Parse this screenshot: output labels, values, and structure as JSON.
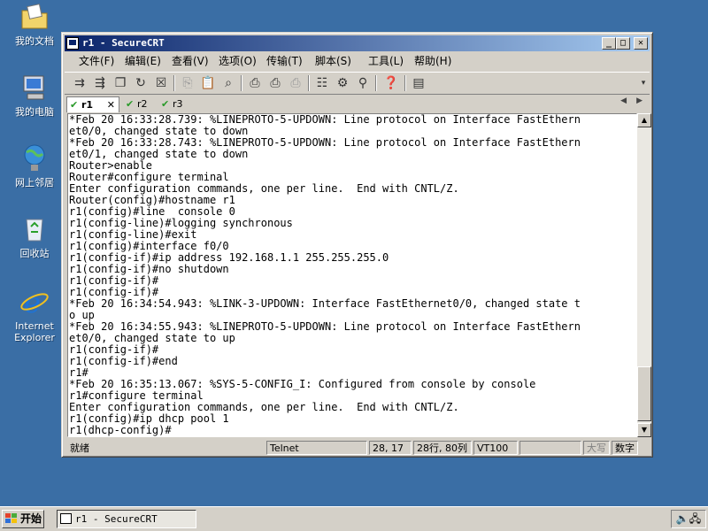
{
  "desktop": {
    "icons": [
      {
        "label": "我的文档",
        "icon": "folder-documents-icon"
      },
      {
        "label": "我的电脑",
        "icon": "computer-icon"
      },
      {
        "label": "网上邻居",
        "icon": "network-icon"
      },
      {
        "label": "回收站",
        "icon": "recycle-bin-icon"
      },
      {
        "label": "Internet Explorer",
        "icon": "ie-icon"
      }
    ]
  },
  "window": {
    "title": "r1 - SecureCRT",
    "controls": {
      "minimize": "_",
      "maximize": "□",
      "close": "✕"
    }
  },
  "menu": [
    "文件(F)",
    "编辑(E)",
    "查看(V)",
    "选项(O)",
    "传输(T)",
    "脚本(S)",
    "工具(L)",
    "帮助(H)"
  ],
  "tabs": [
    {
      "label": "r1",
      "active": true,
      "close": "✕"
    },
    {
      "label": "r2",
      "active": false
    },
    {
      "label": "r3",
      "active": false
    }
  ],
  "terminal": {
    "lines": [
      "*Feb 20 16:33:28.739: %LINEPROTO-5-UPDOWN: Line protocol on Interface FastEthern",
      "et0/0, changed state to down",
      "*Feb 20 16:33:28.743: %LINEPROTO-5-UPDOWN: Line protocol on Interface FastEthern",
      "et0/1, changed state to down",
      "Router>enable",
      "Router#configure terminal",
      "Enter configuration commands, one per line.  End with CNTL/Z.",
      "Router(config)#hostname r1",
      "r1(config)#line  console 0",
      "r1(config-line)#logging synchronous",
      "r1(config-line)#exit",
      "r1(config)#interface f0/0",
      "r1(config-if)#ip address 192.168.1.1 255.255.255.0",
      "r1(config-if)#no shutdown",
      "r1(config-if)#",
      "r1(config-if)#",
      "*Feb 20 16:34:54.943: %LINK-3-UPDOWN: Interface FastEthernet0/0, changed state t",
      "o up",
      "*Feb 20 16:34:55.943: %LINEPROTO-5-UPDOWN: Line protocol on Interface FastEthern",
      "et0/0, changed state to up",
      "r1(config-if)#",
      "r1(config-if)#end",
      "r1#",
      "*Feb 20 16:35:13.067: %SYS-5-CONFIG_I: Configured from console by console",
      "r1#configure terminal",
      "Enter configuration commands, one per line.  End with CNTL/Z.",
      "r1(config)#ip dhcp pool 1",
      "r1(dhcp-config)#"
    ]
  },
  "status": {
    "ready": "就绪",
    "protocol": "Telnet",
    "cursor": "28, 17",
    "size": "28行, 80列",
    "emulation": "VT100",
    "caps": "大写",
    "num": "数字"
  },
  "taskbar": {
    "start": "开始",
    "task": "r1 - SecureCRT"
  }
}
